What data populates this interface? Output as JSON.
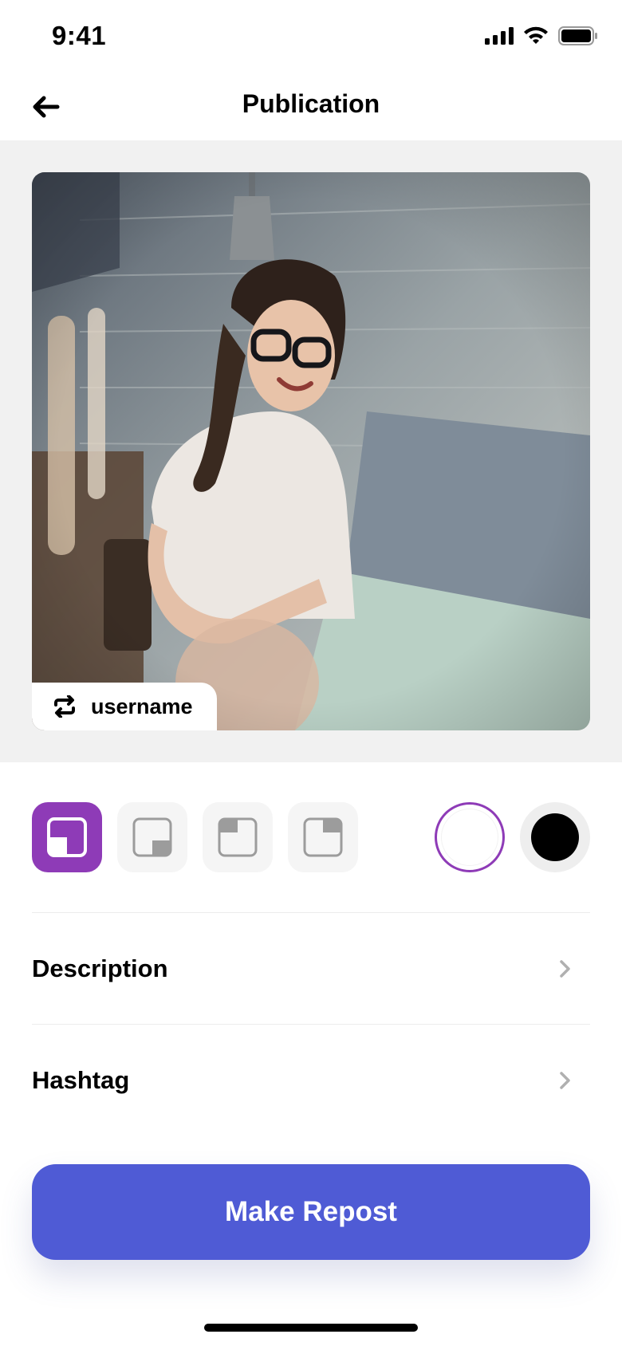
{
  "status_bar": {
    "time": "9:41",
    "icons": [
      "signal-icon",
      "wifi-icon",
      "battery-icon"
    ]
  },
  "nav": {
    "title": "Publication",
    "back_icon": "arrow-left-icon"
  },
  "photo": {
    "description_icon": "photo-placeholder",
    "repost_tag": {
      "icon": "repost-icon",
      "label": "username"
    }
  },
  "position_options": [
    {
      "name": "bottom-left",
      "selected": true
    },
    {
      "name": "bottom-right",
      "selected": false
    },
    {
      "name": "top-left",
      "selected": false
    },
    {
      "name": "top-right",
      "selected": false
    }
  ],
  "color_options": [
    {
      "name": "white",
      "color": "#ffffff",
      "selected": true
    },
    {
      "name": "black",
      "color": "#000000",
      "selected": false
    }
  ],
  "menu": {
    "description_label": "Description",
    "hashtag_label": "Hashtag"
  },
  "actions": {
    "make_repost_label": "Make Repost"
  },
  "colors": {
    "accent_purple": "#8e3bb7",
    "primary_button": "#4f5bd5",
    "background_gray": "#f1f1f1"
  }
}
